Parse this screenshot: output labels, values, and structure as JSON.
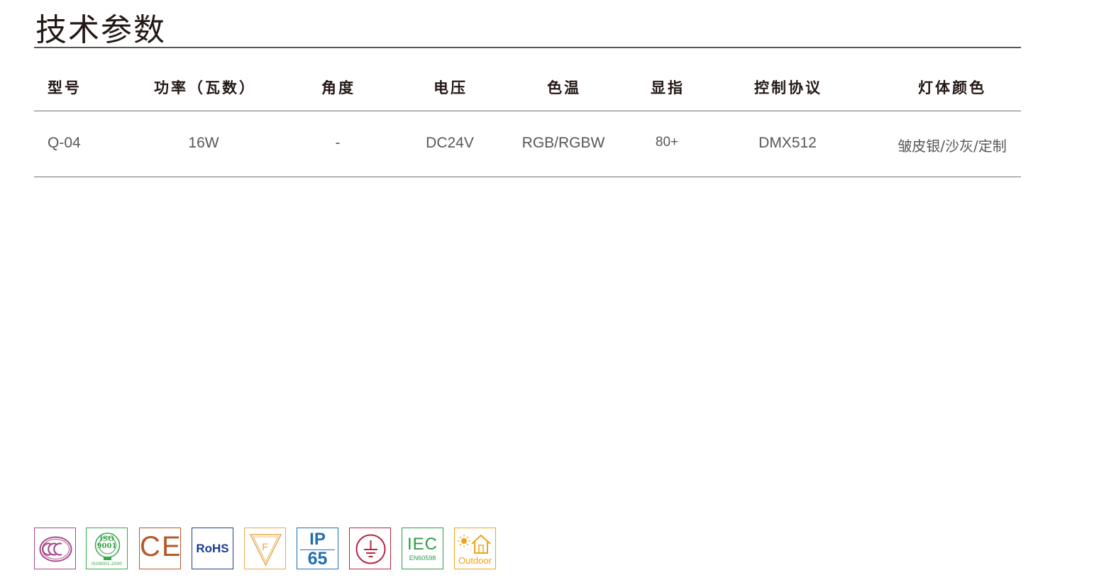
{
  "title": "技术参数",
  "table": {
    "headers": [
      "型号",
      "功率（瓦数）",
      "角度",
      "电压",
      "色温",
      "显指",
      "控制协议",
      "灯体颜色"
    ],
    "rows": [
      [
        "Q-04",
        "16W",
        "-",
        "DC24V",
        "RGB/RGBW",
        "80+",
        "DMX512",
        "皱皮银/沙灰/定制"
      ]
    ]
  },
  "certifications": [
    {
      "name": "CCC",
      "icon": "ccc-mark-icon",
      "color": "#a64a8a"
    },
    {
      "name": "ISO 9001",
      "icon": "iso9001-icon",
      "color": "#3aa64a",
      "top_text": "ISO",
      "mid_text": "9001",
      "bottom_text": "ISO9001-2000"
    },
    {
      "name": "CE",
      "icon": "ce-mark-icon",
      "color": "#b7582b",
      "text": "CE"
    },
    {
      "name": "RoHS",
      "icon": "rohs-icon",
      "color": "#1d3c8f",
      "text": "RoHS"
    },
    {
      "name": "F mark",
      "icon": "f-triangle-icon",
      "color": "#e7a84a",
      "text": "F"
    },
    {
      "name": "IP65",
      "icon": "ip65-icon",
      "color": "#1f6fb5",
      "top_text": "IP",
      "bottom_text": "65"
    },
    {
      "name": "Earth ground",
      "icon": "ground-symbol-icon",
      "color": "#b5263f"
    },
    {
      "name": "IEC",
      "icon": "iec-icon",
      "color": "#2e9b48",
      "text": "IEC",
      "sub_text": "EN60598"
    },
    {
      "name": "Outdoor",
      "icon": "outdoor-house-icon",
      "color": "#f0a21a",
      "text": "Outdoor"
    }
  ]
}
